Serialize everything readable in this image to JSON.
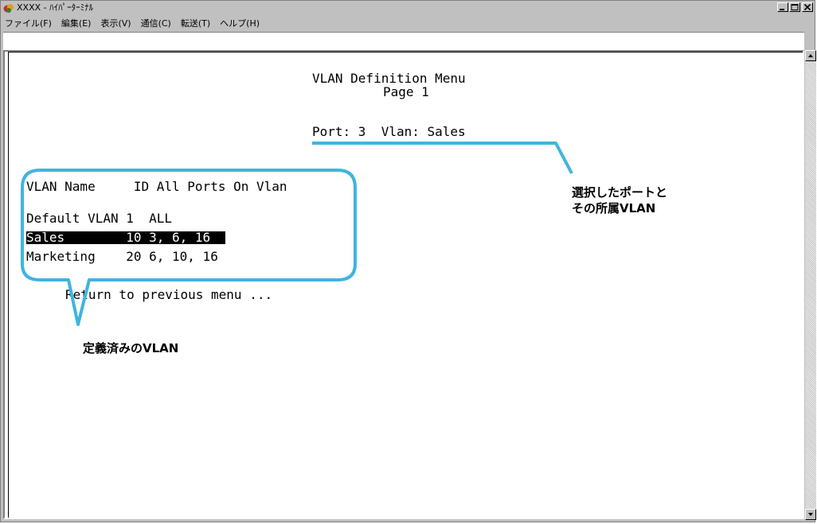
{
  "window": {
    "title": "XXXX - ﾊｲﾊﾟｰﾀｰﾐﾅﾙ",
    "buttons": [
      "minimize",
      "maximize",
      "close"
    ]
  },
  "menu": [
    {
      "label": "ファイル(F)"
    },
    {
      "label": "編集(E)"
    },
    {
      "label": "表示(V)"
    },
    {
      "label": "通信(C)"
    },
    {
      "label": "転送(T)"
    },
    {
      "label": "ヘルプ(H)"
    }
  ],
  "terminal": {
    "title": "VLAN Definition Menu",
    "page": "Page 1",
    "status": "Port: 3  Vlan: Sales",
    "header": "VLAN Name     ID All Ports On Vlan",
    "rows": [
      {
        "text": "Default VLAN 1  ALL",
        "selected": false
      },
      {
        "text": "Sales        10 3, 6, 16  ",
        "selected": true
      },
      {
        "text": "Marketing    20 6, 10, 16",
        "selected": false
      }
    ],
    "return": "Return to previous menu ..."
  },
  "annotations": {
    "selected_port_line1": "選択したポートと",
    "selected_port_line2": "その所属VLAN",
    "defined_vlans": "定義済みのVLAN"
  },
  "colors": {
    "callout": "#40b4e0",
    "chrome": "#c0c0c0"
  },
  "icons": [
    "hyperterminal-app-icon",
    "minimize-icon",
    "maximize-icon",
    "close-icon",
    "scroll-up-arrow-icon",
    "scroll-down-arrow-icon"
  ]
}
